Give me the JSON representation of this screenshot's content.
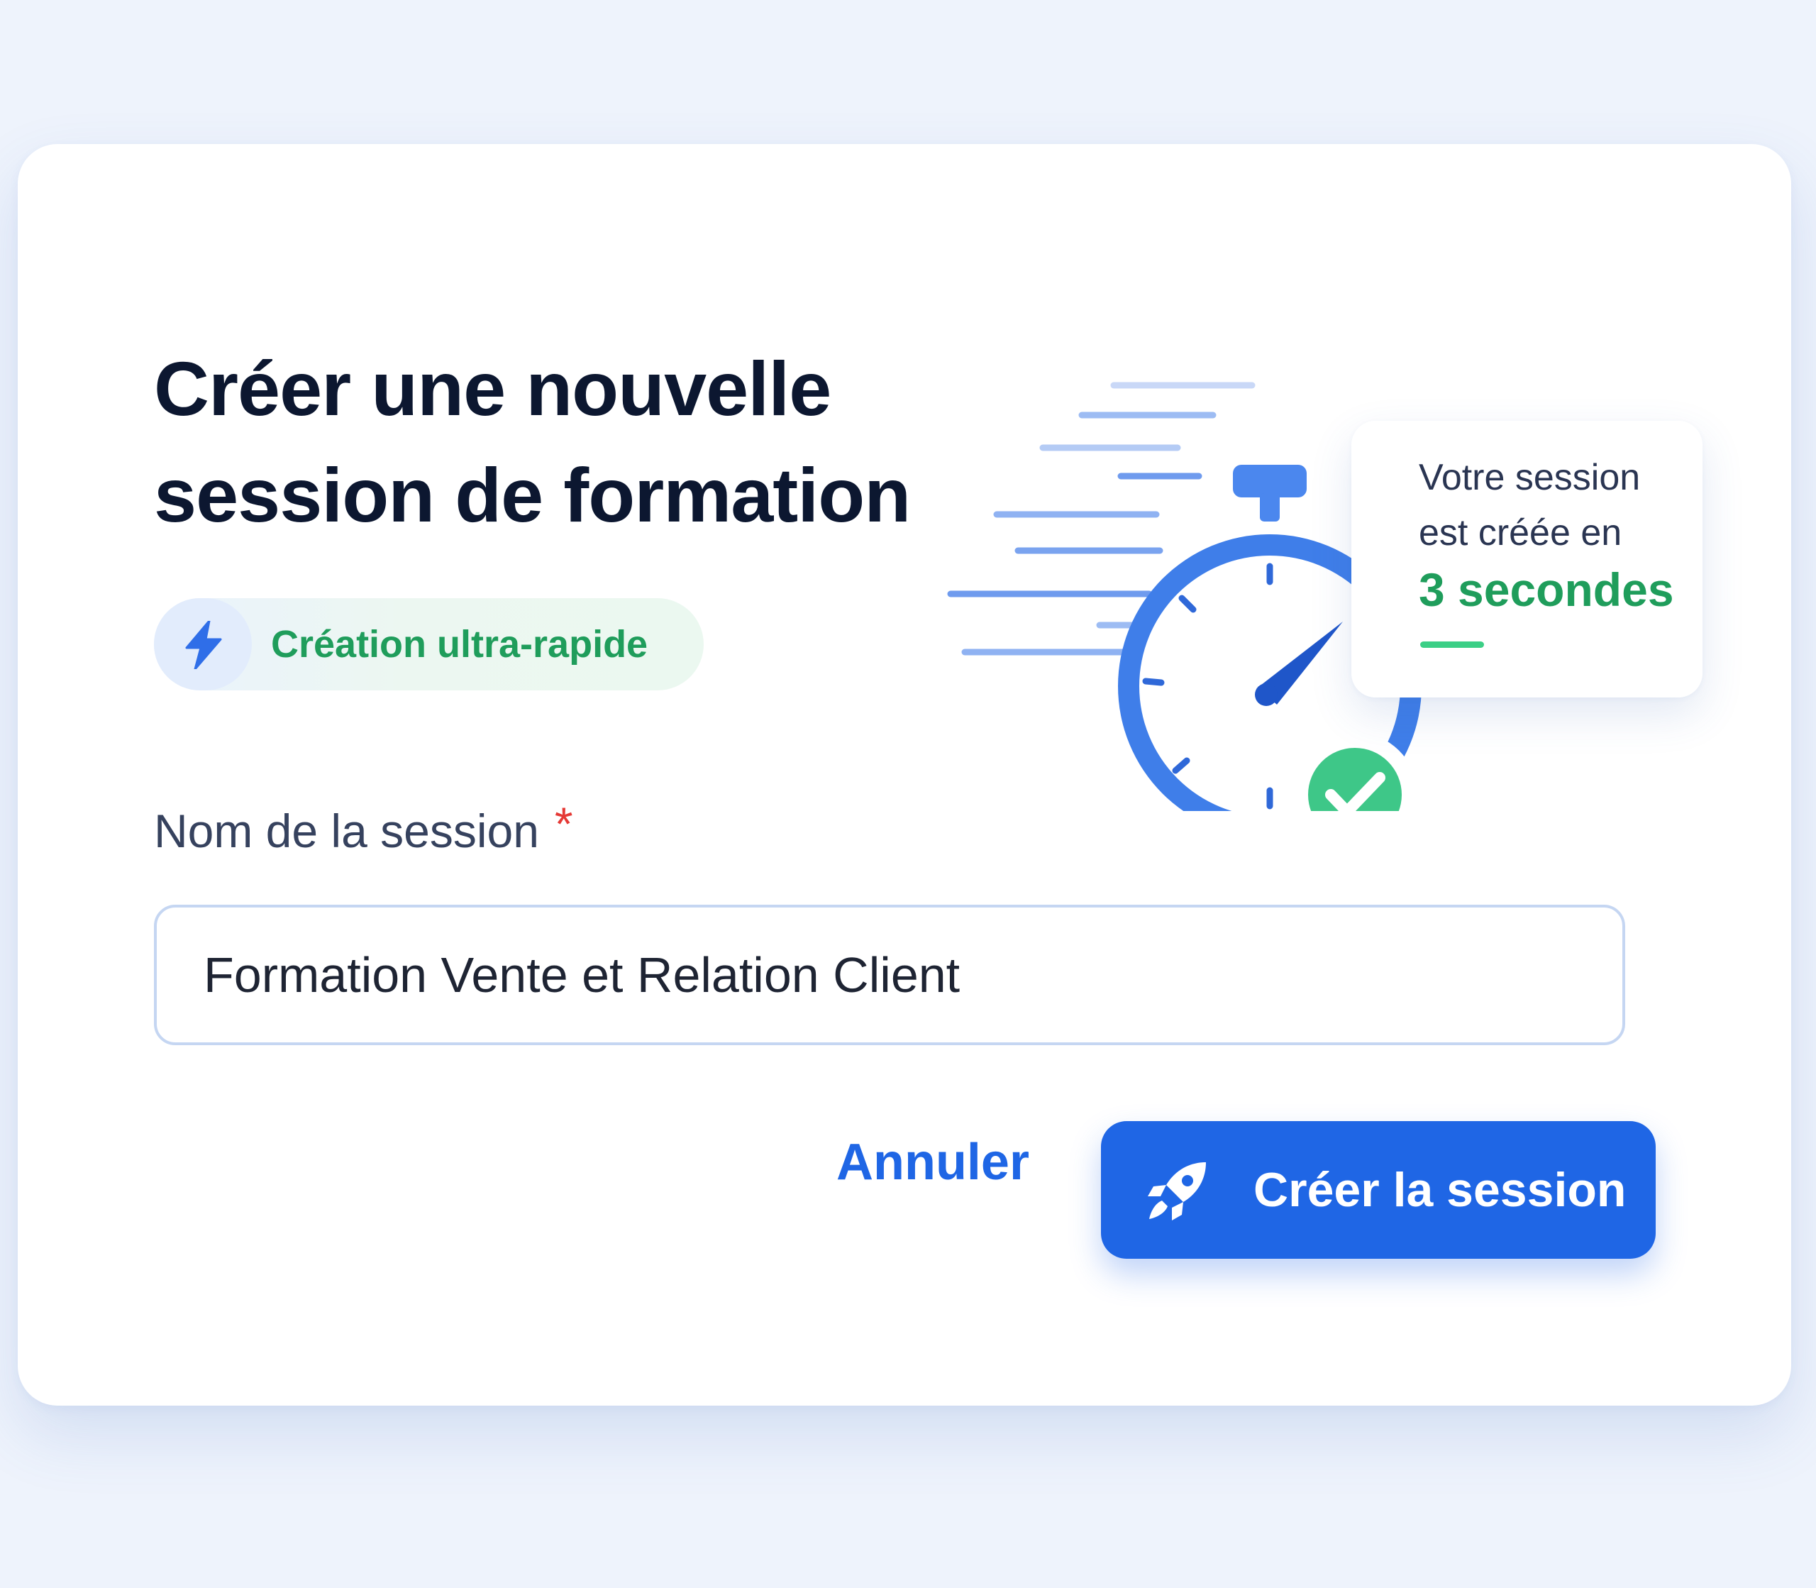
{
  "dialog": {
    "title": "Créer une nouvelle session de formation",
    "badge": {
      "label": "Création ultra-rapide",
      "icon": "lightning-bolt-icon"
    },
    "illustration": {
      "icon": "stopwatch-icon",
      "check_icon": "check-circle-icon",
      "info_line1": "Votre session",
      "info_line2": "est créée en",
      "info_highlight": "3 secondes"
    },
    "field": {
      "label": "Nom de la session",
      "required_marker": "*",
      "value": "Formation Vente et Relation Client"
    },
    "actions": {
      "cancel_label": "Annuler",
      "create_label": "Créer la session",
      "create_icon": "rocket-icon"
    }
  },
  "colors": {
    "page_background": "#eef3fc",
    "primary": "#1f66e5",
    "success": "#1f9d5b",
    "success_light": "#3ccf86",
    "required": "#e53935",
    "title_text": "#0c1730"
  }
}
